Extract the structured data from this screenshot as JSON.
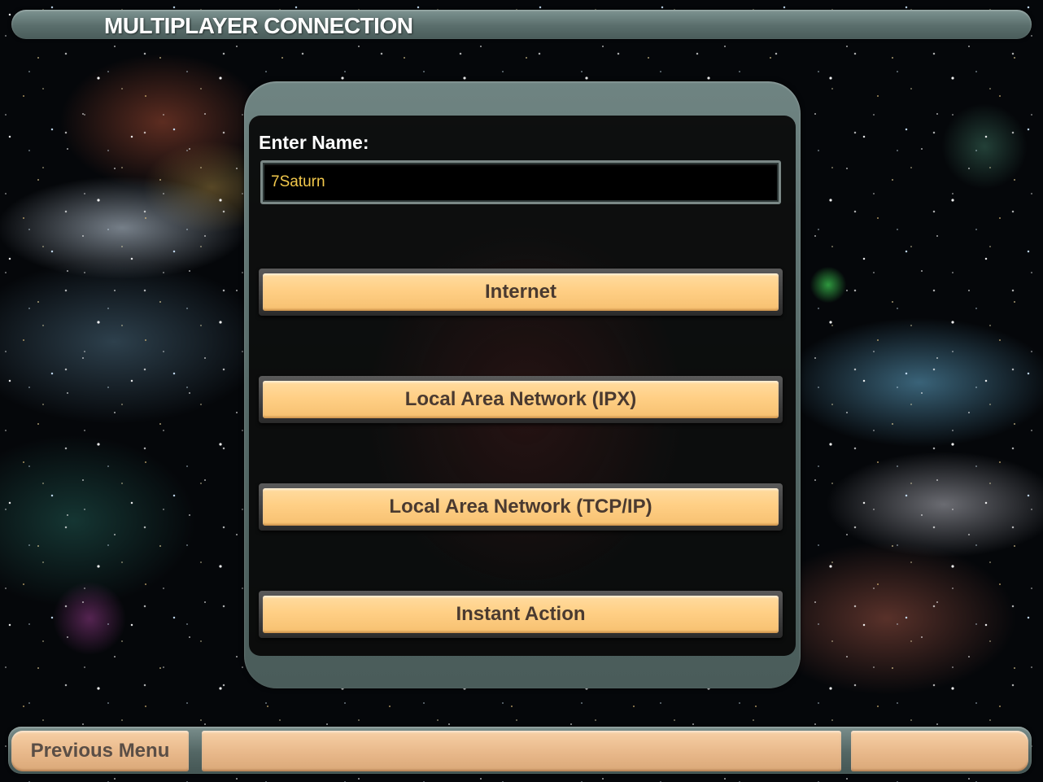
{
  "window": {
    "title": "MULTIPLAYER CONNECTION"
  },
  "form": {
    "name_label": "Enter Name:",
    "name_value": "7Saturn"
  },
  "connection_options": [
    {
      "label": "Internet"
    },
    {
      "label": "Local Area Network (IPX)"
    },
    {
      "label": "Local Area Network (TCP/IP)"
    },
    {
      "label": "Instant Action"
    }
  ],
  "footer": {
    "previous_label": "Previous Menu"
  },
  "colors": {
    "button_face": "#ffcf85",
    "button_text": "#4a3a30",
    "frame_teal": "#5a6e6c",
    "input_text": "#f2c84b",
    "footer_button": "#e8b88a"
  }
}
